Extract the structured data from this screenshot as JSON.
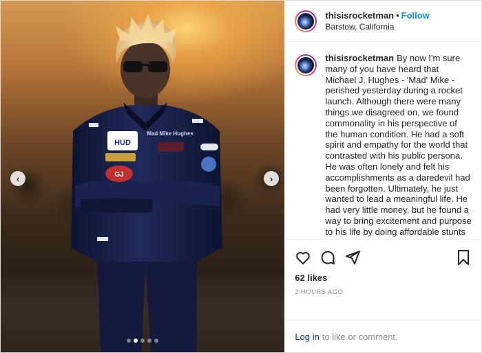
{
  "post": {
    "username": "thisisrocketman",
    "separator": "•",
    "follow_label": "Follow",
    "location": "Barstow, California",
    "caption": "By now I'm sure many of you have heard that Michael J. Hughes - 'Mad' Mike - perished yesterday during a rocket launch. Although there were many things we disagreed on, we found commonality in his perspective of the human condition. He had a soft spirit and empathy for the world that contrasted with his public persona. He was often lonely and felt his accomplishments as a daredevil had been forgotten. Ultimately, he just wanted to lead a meaningful life. He had very little money, but he found a way to bring excitement and purpose to his life by doing affordable stunts with rockets that he built himself using spare parts. His flat Earth perspective brought attention and needed funds to his",
    "likes": "62 likes",
    "timestamp": "2 HOURS AGO",
    "login_label": "Log in",
    "login_suffix": "to like or comment."
  },
  "suit": {
    "name_patch": "Mad Mike Hughes",
    "badge_1": "HUD",
    "badge_2": "GJ"
  },
  "carousel": {
    "prev_icon": "chevron-left-icon",
    "next_icon": "chevron-right-icon",
    "slide_count": 5,
    "active_index": 1
  },
  "icons": {
    "like": "heart-icon",
    "comment": "comment-icon",
    "share": "share-icon",
    "save": "bookmark-icon"
  },
  "colors": {
    "accent": "#0095f6",
    "muted": "#8e8e8e",
    "link": "#00376b"
  }
}
